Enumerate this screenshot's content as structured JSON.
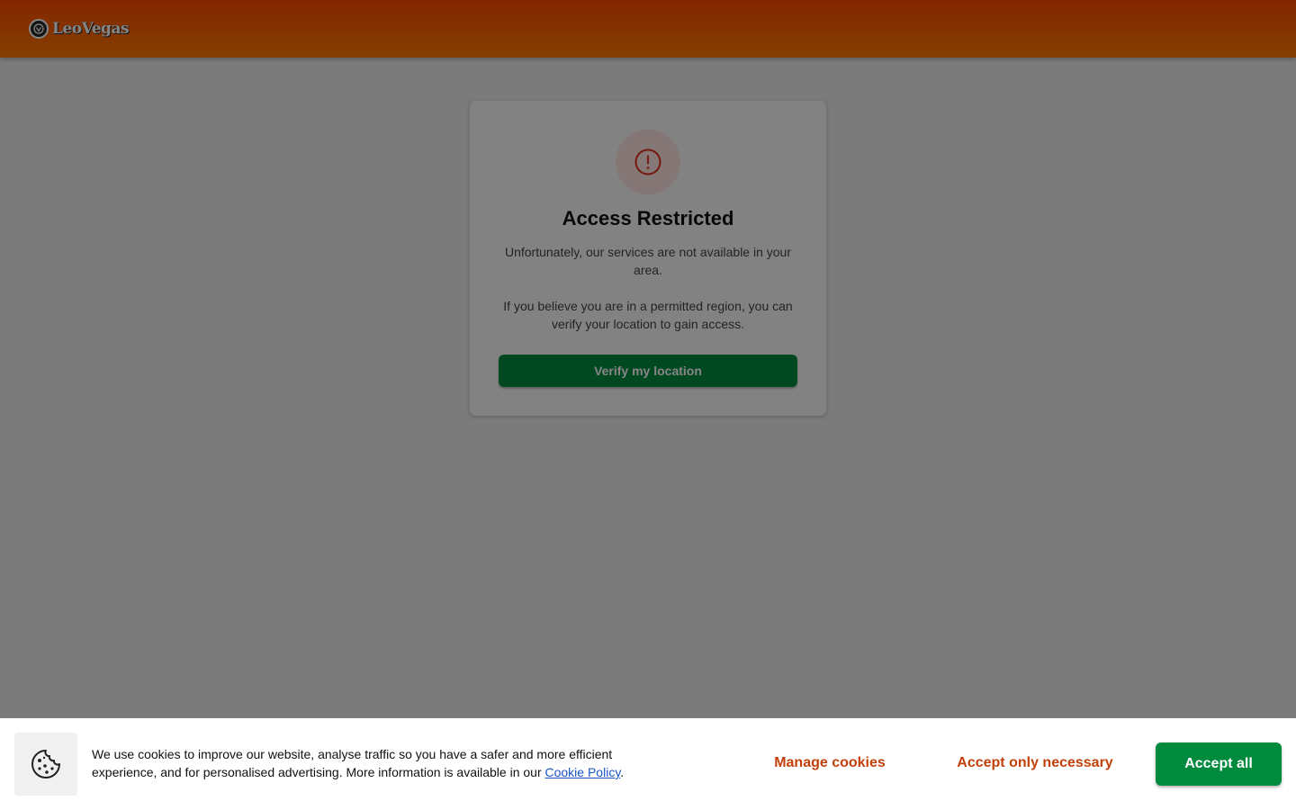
{
  "header": {
    "logo_text": "LeoVegas"
  },
  "restriction": {
    "title": "Access Restricted",
    "message_1": "Unfortunately, our services are not available in your area.",
    "message_2": "If you believe you are in a permitted region, you can verify your location to gain access.",
    "verify_label": "Verify my location",
    "icon": "alert-circle-icon"
  },
  "cookie_banner": {
    "text": "We use cookies to improve our website, analyse traffic so you have a safer and more efficient experience, and for personalised advertising. More information is available in our ",
    "link_text": "Cookie Policy",
    "text_end": ".",
    "manage_label": "Manage cookies",
    "necessary_label": "Accept only necessary",
    "accept_label": "Accept all",
    "icon": "cookie-icon"
  },
  "colors": {
    "header_start": "#fd4a00",
    "header_end": "#ff7a00",
    "primary_green": "#008a3e",
    "link_orange": "#c4400a",
    "alert_red": "#e0301e"
  }
}
